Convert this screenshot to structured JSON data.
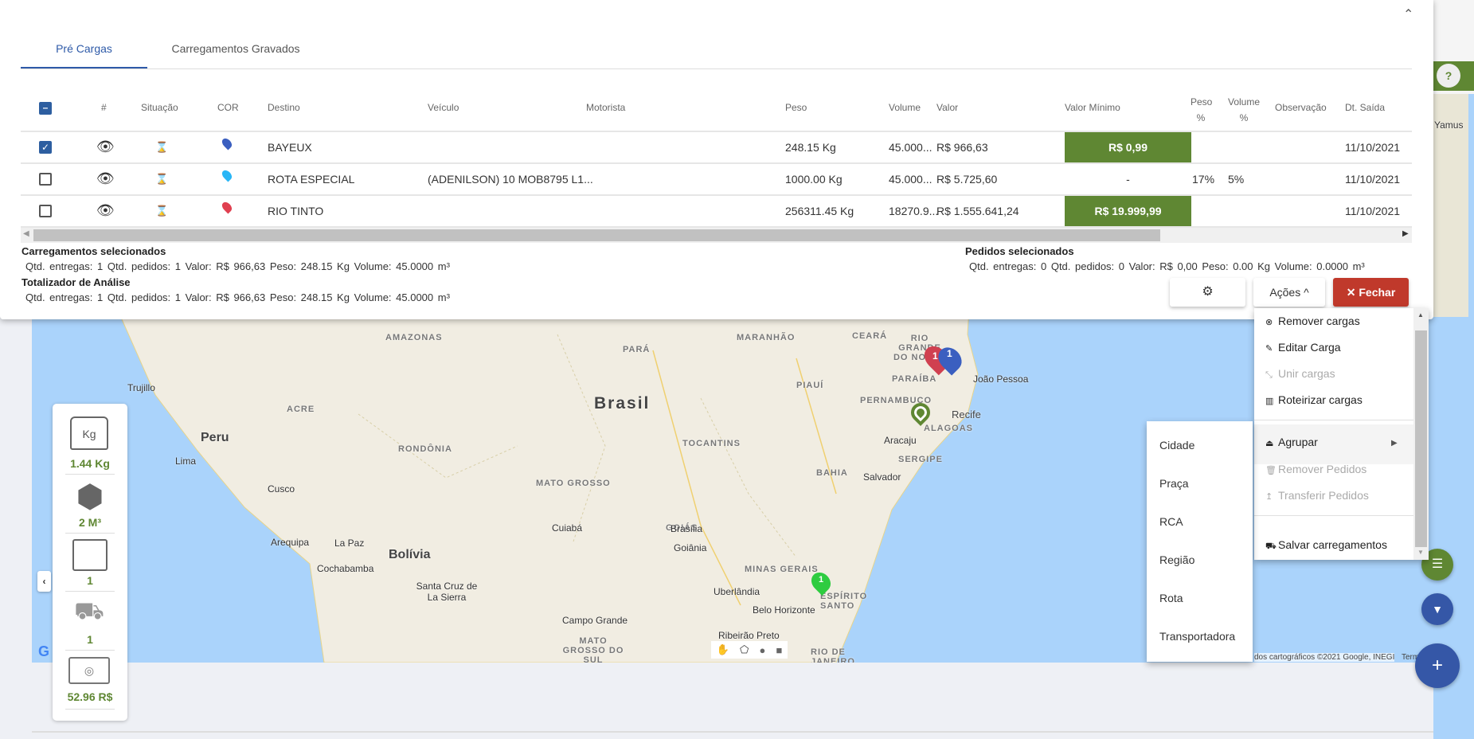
{
  "tabs": [
    {
      "label": "Pré Cargas",
      "active": true
    },
    {
      "label": "Carregamentos Gravados",
      "active": false
    }
  ],
  "table": {
    "headers": {
      "index": "#",
      "situacao": "Situação",
      "cor": "COR",
      "destino": "Destino",
      "veiculo": "Veículo",
      "motorista": "Motorista",
      "peso": "Peso",
      "volume": "Volume",
      "valor": "Valor",
      "valor_minimo": "Valor Mínimo",
      "peso_pct": "Peso %",
      "volume_pct": "Volume %",
      "observacao": "Observação",
      "dt_saida": "Dt. Saída"
    },
    "rows": [
      {
        "checked": true,
        "color": "#3b5fc0",
        "destino": "BAYEUX",
        "veiculo": "",
        "motorista": "",
        "peso": "248.15 Kg",
        "volume": "45.000...",
        "valor": "R$ 966,63",
        "valor_minimo": "R$ 0,99",
        "valor_minimo_highlight": true,
        "peso_pct": "",
        "volume_pct": "",
        "observacao": "",
        "dt_saida": "11/10/2021"
      },
      {
        "checked": false,
        "color": "#29b6f6",
        "destino": "ROTA ESPECIAL",
        "veiculo": "(ADENILSON) 10 MOB8795 L1...",
        "motorista": "",
        "peso": "1000.00 Kg",
        "volume": "45.000...",
        "valor": "R$ 5.725,60",
        "valor_minimo": "-",
        "valor_minimo_highlight": false,
        "peso_pct": "17%",
        "volume_pct": "5%",
        "observacao": "",
        "dt_saida": "11/10/2021"
      },
      {
        "checked": false,
        "color": "#e04050",
        "destino": "RIO TINTO",
        "veiculo": "",
        "motorista": "",
        "peso": "256311.45 Kg",
        "volume": "18270.9...",
        "valor": "R$ 1.555.641,24",
        "valor_minimo": "R$ 19.999,99",
        "valor_minimo_highlight": true,
        "peso_pct": "",
        "volume_pct": "",
        "observacao": "",
        "dt_saida": "11/10/2021"
      }
    ]
  },
  "summary": {
    "carregamentos_title": "Carregamentos selecionados",
    "carregamentos_line": "Qtd. entregas: 1  Qtd. pedidos: 1  Valor: R$ 966,63  Peso: 248.15 Kg  Volume: 45.0000 m³",
    "totalizador_title": "Totalizador de Análise",
    "totalizador_line": "Qtd. entregas: 1  Qtd. pedidos: 1  Valor: R$ 966,63  Peso: 248.15 Kg  Volume: 45.0000 m³",
    "pedidos_title": "Pedidos selecionados",
    "pedidos_line": "Qtd. entregas: 0  Qtd. pedidos: 0  Valor: R$ 0,00  Peso: 0.00 Kg  Volume: 0.0000 m³"
  },
  "buttons": {
    "acoes": "Ações ^",
    "fechar": "✕ Fechar"
  },
  "actions_menu": [
    {
      "label": "Remover cargas",
      "icon": "⊗",
      "disabled": false
    },
    {
      "label": "Editar Carga",
      "icon": "✎",
      "disabled": false
    },
    {
      "label": "Unir cargas",
      "icon": "⤡",
      "disabled": true
    },
    {
      "label": "Roteirizar cargas",
      "icon": "▥",
      "disabled": false
    },
    {
      "label": "Agrupar",
      "icon": "⏏",
      "disabled": false
    },
    {
      "label": "Remover Pedidos",
      "icon": "🗑",
      "disabled": true
    },
    {
      "label": "Transferir Pedidos",
      "icon": "↥",
      "disabled": true
    },
    {
      "label": "Salvar carregamentos",
      "icon": "⛟",
      "disabled": false
    }
  ],
  "submenu": [
    "Cidade",
    "Praça",
    "RCA",
    "Região",
    "Rota",
    "Transportadora"
  ],
  "stats": {
    "peso": "1.44 Kg",
    "volume": "2 M³",
    "pedidos": "1",
    "veiculos": "1",
    "valor": "52.96 R$"
  },
  "map": {
    "states": [
      "AMAZONAS",
      "PARÁ",
      "MARANHÃO",
      "CEARÁ",
      "RIO GRANDE DO NORTE",
      "PARAÍBA",
      "PIAUÍ",
      "ACRE",
      "PERNAMBUCO",
      "ALAGOAS",
      "TOCANTINS",
      "RONDÔNIA",
      "SERGIPE",
      "BAHIA",
      "MATO GROSSO",
      "GOIÁS",
      "MINAS GERAIS",
      "ESPÍRITO SANTO",
      "MATO GROSSO DO SUL",
      "RIO DE JANEIRO"
    ],
    "cities": [
      "João Pessoa",
      "Recife",
      "Aracaju",
      "Salvador",
      "Lima",
      "Cusco",
      "Trujillo",
      "Brasília",
      "Cuiabá",
      "Goiânia",
      "La Paz",
      "Arequipa",
      "Cochabamba",
      "Santa Cruz de La Sierra",
      "Uberlândia",
      "Belo Horizonte",
      "Campo Grande",
      "Ribeirão Preto",
      "Yamus"
    ],
    "countries": [
      "Brasil",
      "Peru",
      "Bolívia"
    ],
    "attribution": "dos cartográficos ©2021 Google, INEGI",
    "terms": "Term",
    "marker_label": "1"
  },
  "colors": {
    "accent": "#2e5aa8",
    "green": "#5f8733",
    "red": "#c0392b"
  }
}
